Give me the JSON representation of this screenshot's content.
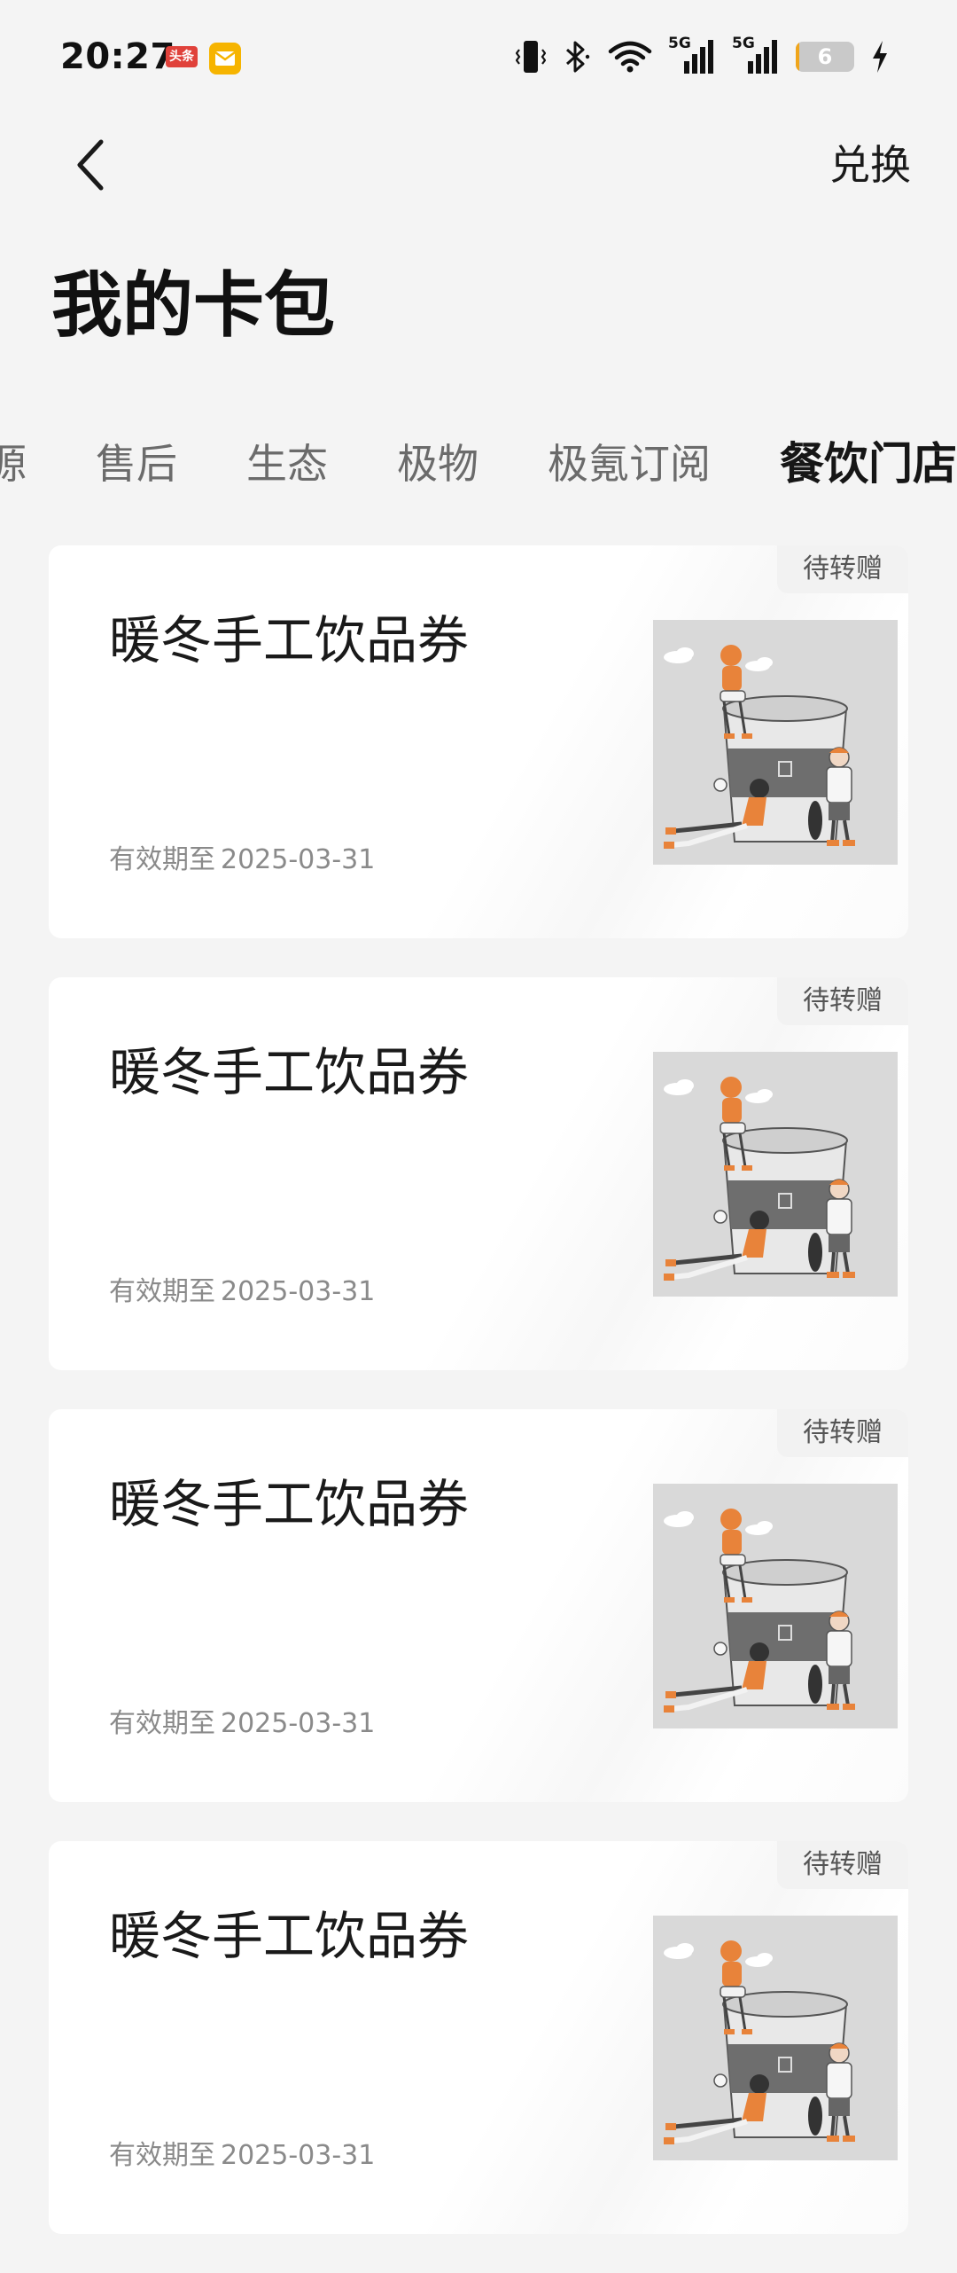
{
  "status_bar": {
    "time": "20:27",
    "notification_badge": "头条",
    "battery_level": "6",
    "battery_fraction": 0.06,
    "battery_color": "#f0a51a",
    "network_labels": [
      "5G",
      "5G"
    ]
  },
  "header": {
    "back_icon": "chevron-left-icon",
    "exchange_label": "兑换",
    "title": "我的卡包"
  },
  "tabs": [
    {
      "label": "源",
      "active": false
    },
    {
      "label": "售后",
      "active": false
    },
    {
      "label": "生态",
      "active": false
    },
    {
      "label": "极物",
      "active": false
    },
    {
      "label": "极氪订阅",
      "active": false
    },
    {
      "label": "餐饮门店",
      "active": true
    }
  ],
  "coupons": [
    {
      "title": "暖冬手工饮品券",
      "expiry_prefix": "有效期至",
      "expiry_date": "2025-03-31",
      "badge": "待转赠",
      "image_icon": "drink-coupon-illustration"
    },
    {
      "title": "暖冬手工饮品券",
      "expiry_prefix": "有效期至",
      "expiry_date": "2025-03-31",
      "badge": "待转赠",
      "image_icon": "drink-coupon-illustration"
    },
    {
      "title": "暖冬手工饮品券",
      "expiry_prefix": "有效期至",
      "expiry_date": "2025-03-31",
      "badge": "待转赠",
      "image_icon": "drink-coupon-illustration"
    },
    {
      "title": "暖冬手工饮品券",
      "expiry_prefix": "有效期至",
      "expiry_date": "2025-03-31",
      "badge": "待转赠",
      "image_icon": "drink-coupon-illustration"
    }
  ],
  "colors": {
    "background": "#f4f4f4",
    "card": "#ffffff",
    "accent_orange": "#e8833a"
  }
}
